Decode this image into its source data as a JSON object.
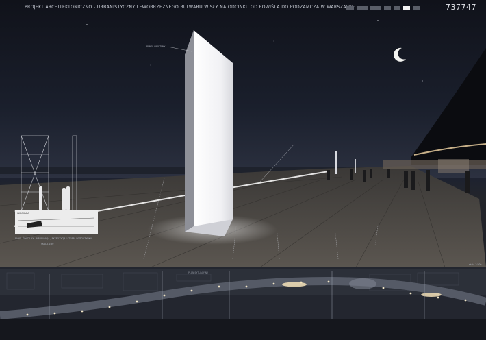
{
  "header": {
    "title": "PROJEKT ARCHITEKTONICZNO - URBANISTYCZNY LEWOBRZEŻNEGO BULWARU WISŁY NA ODCINKU OD POWIŚLA DO PODZAMCZA W WARSZAWIE",
    "project_number": "737747"
  },
  "sheet_nav": {
    "sheets": [
      {
        "active": false
      },
      {
        "active": false
      },
      {
        "active": false
      },
      {
        "active": false
      },
      {
        "active": false
      },
      {
        "active": true
      },
      {
        "active": false
      }
    ]
  },
  "annotations": {
    "monolith_label": "PANEL ŚWIETLNY",
    "section_label": "WIDOK A-A",
    "legend_text": "PANEL ŚWIETLNY - INFORMACJA / EKSPOZYCJA / STREFA WYPOCZYNKU",
    "scale": "SKALA 1:50",
    "strip_label": "PLAN SYTUACYJNY",
    "footer_label": "skala 1:500"
  },
  "colors": {
    "sky_top": "#0f1118",
    "glow": "#ffffff",
    "paving": "#4a4642",
    "river": "#1f222b"
  }
}
